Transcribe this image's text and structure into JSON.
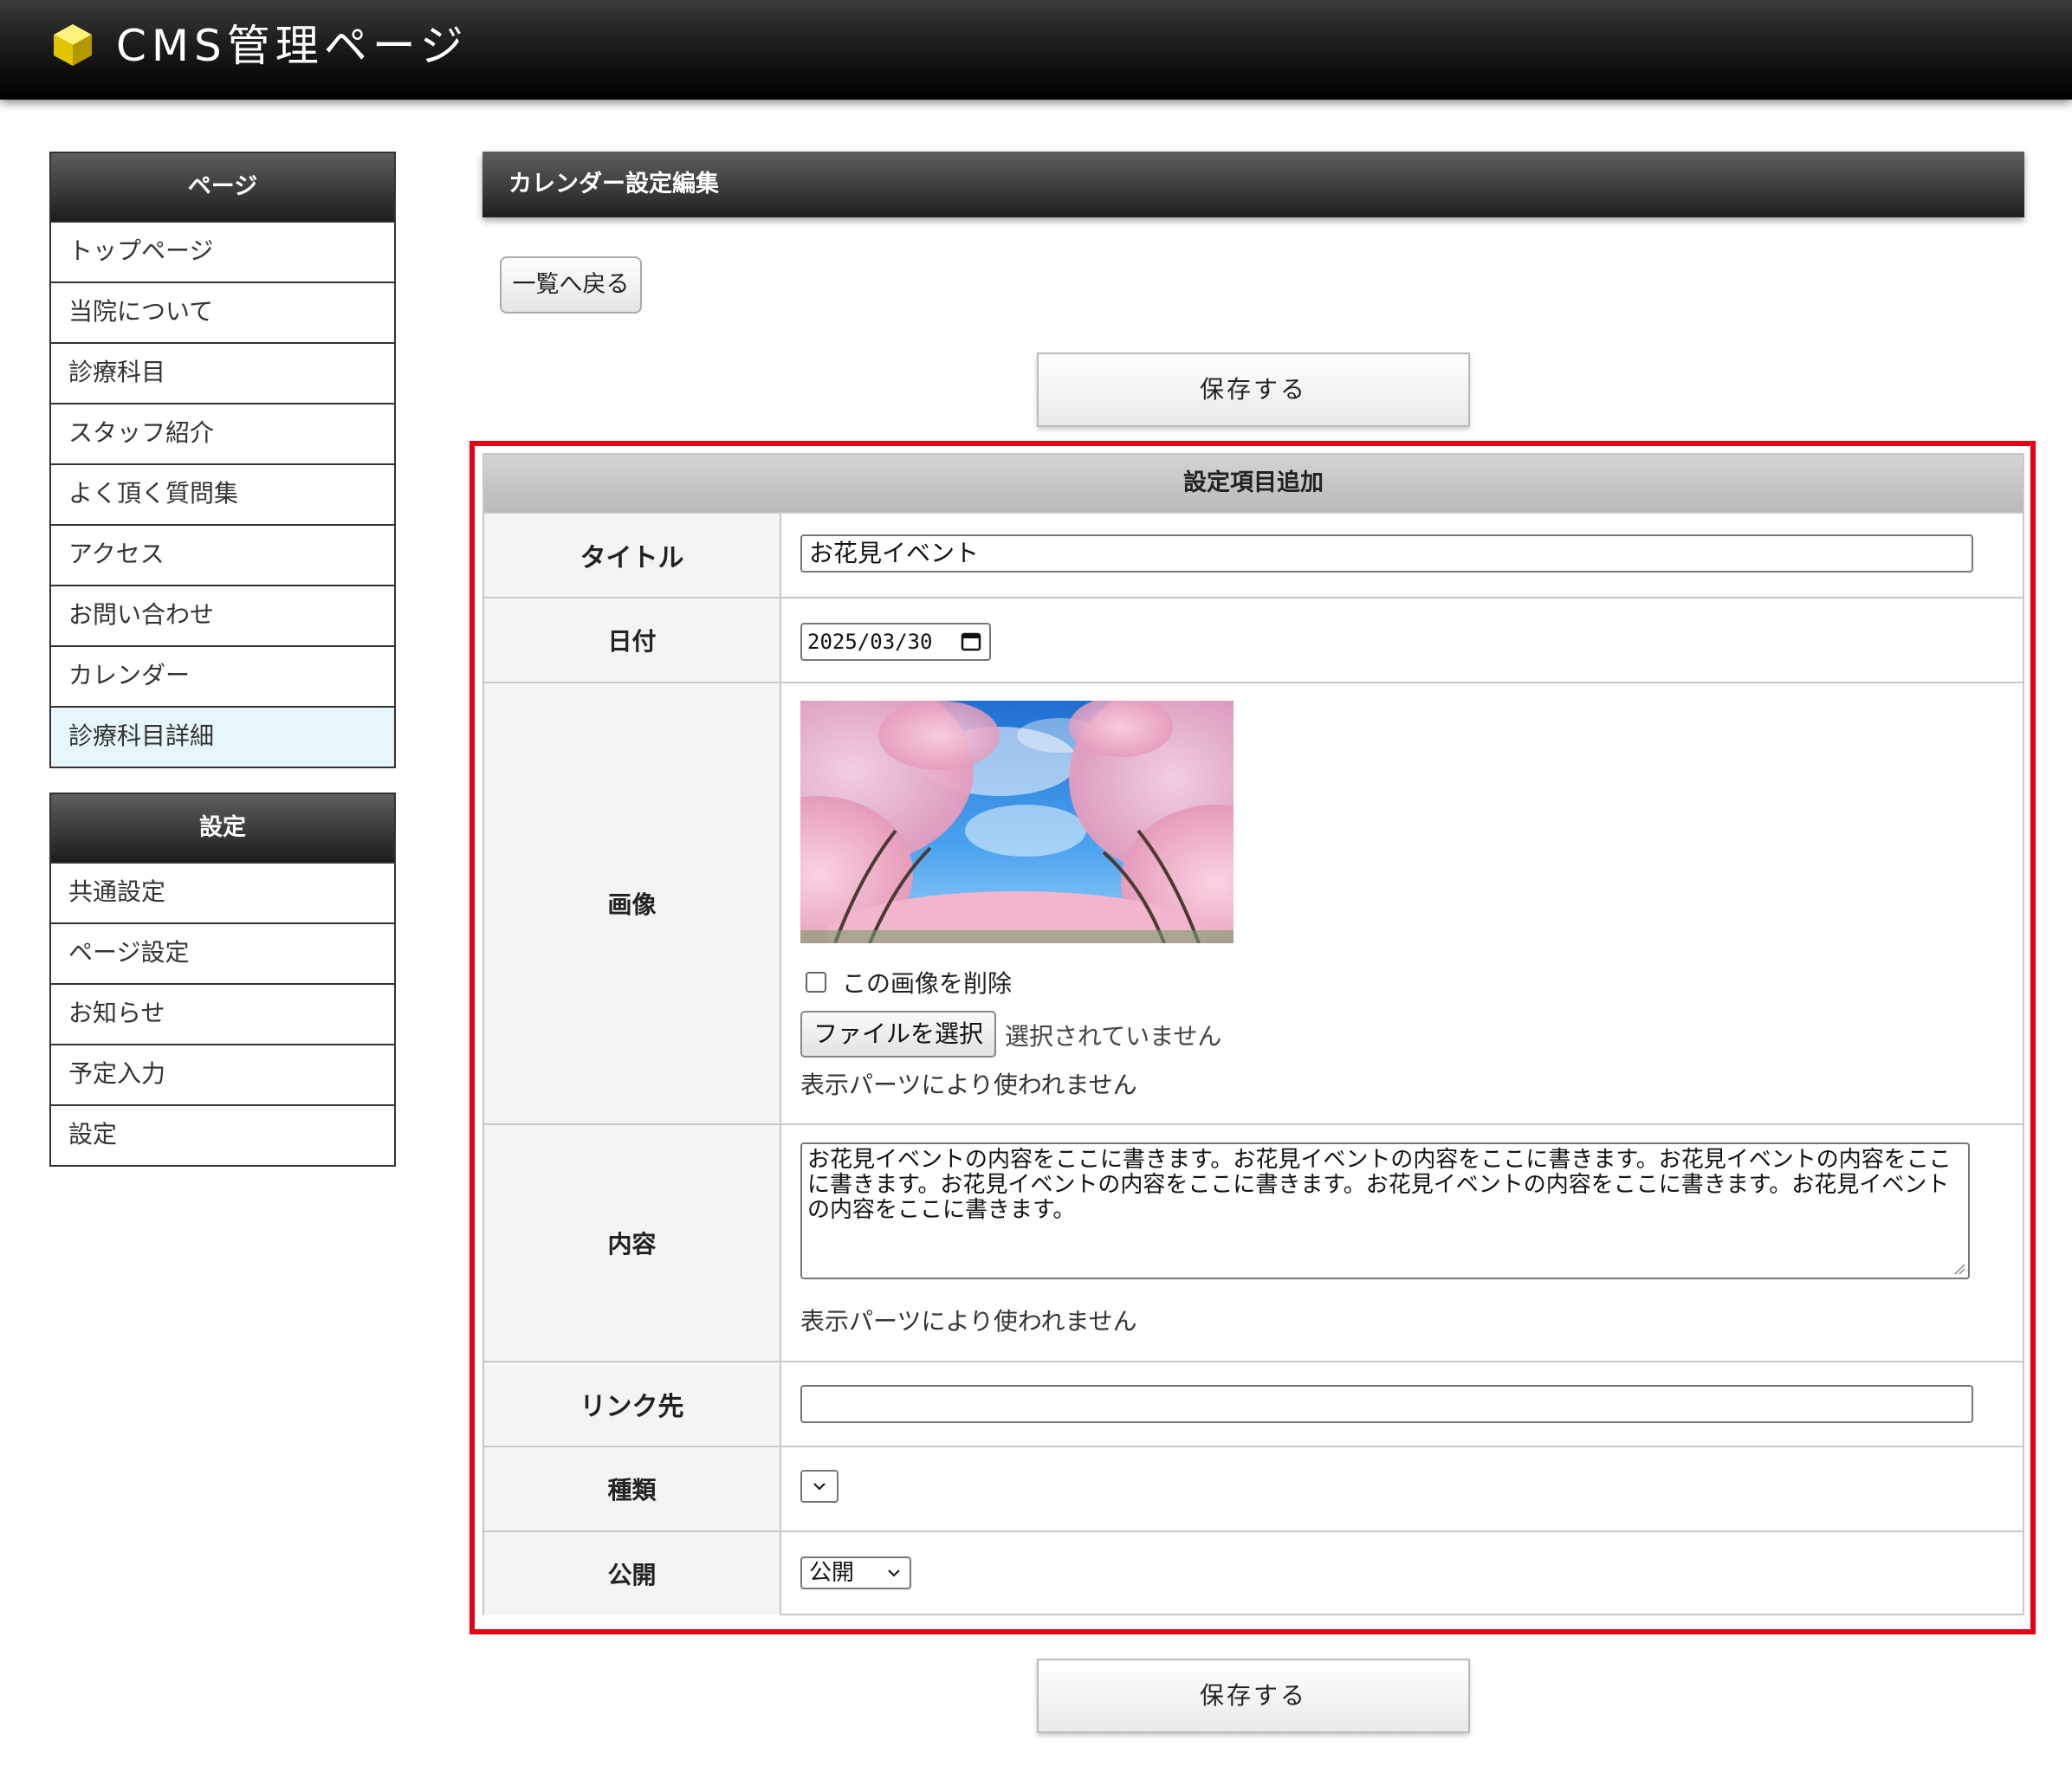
{
  "header": {
    "title": "CMS管理ページ",
    "logo_icon": "yellow-cube-icon"
  },
  "sidebar": {
    "page_section": {
      "title": "ページ",
      "items": [
        {
          "label": "トップページ"
        },
        {
          "label": "当院について"
        },
        {
          "label": "診療科目"
        },
        {
          "label": "スタッフ紹介"
        },
        {
          "label": "よく頂く質問集"
        },
        {
          "label": "アクセス"
        },
        {
          "label": "お問い合わせ"
        },
        {
          "label": "カレンダー"
        },
        {
          "label": "診療科目詳細",
          "active": true
        }
      ]
    },
    "settings_section": {
      "title": "設定",
      "items": [
        {
          "label": "共通設定"
        },
        {
          "label": "ページ設定"
        },
        {
          "label": "お知らせ"
        },
        {
          "label": "予定入力"
        },
        {
          "label": "設定"
        }
      ]
    }
  },
  "main": {
    "page_title": "カレンダー設定編集",
    "back_label": "一覧へ戻る",
    "save_label": "保存する",
    "form": {
      "heading": "設定項目追加",
      "title_label": "タイトル",
      "title_value": "お花見イベント",
      "date_label": "日付",
      "date_value": "2025/03/30",
      "image_label": "画像",
      "delete_image_label": "この画像を削除",
      "delete_image_checked": false,
      "file_button_label": "ファイルを選択",
      "file_status": "選択されていません",
      "image_note": "表示パーツにより使われません",
      "content_label": "内容",
      "content_value": "お花見イベントの内容をここに書きます。お花見イベントの内容をここに書きます。お花見イベントの内容をここに書きます。お花見イベントの内容をここに書きます。お花見イベントの内容をここに書きます。お花見イベントの内容をここに書きます。",
      "content_note": "表示パーツにより使われません",
      "link_label": "リンク先",
      "link_value": "",
      "type_label": "種類",
      "type_value": "",
      "publish_label": "公開",
      "publish_value": "公開"
    }
  },
  "colors": {
    "highlight_border": "#e60012",
    "active_item_bg": "#e6f6fb",
    "logo_yellow": "#f2d600"
  }
}
